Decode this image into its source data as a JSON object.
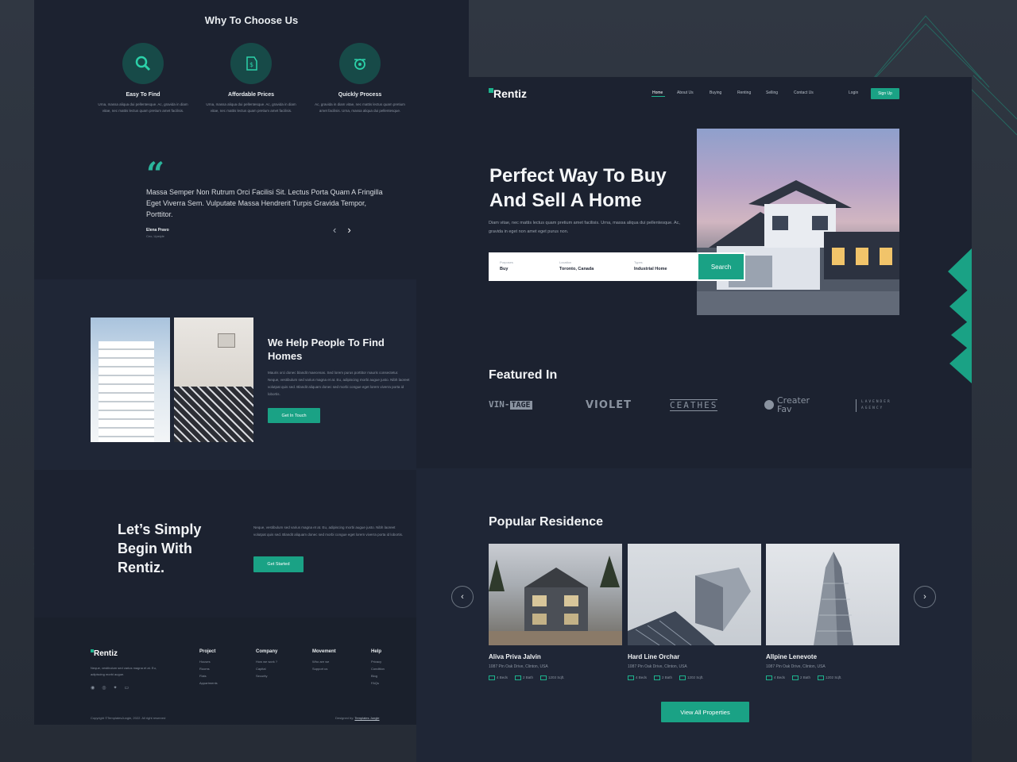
{
  "colors": {
    "accent": "#1aa285",
    "panel": "#1c2230",
    "background": "#2b313c"
  },
  "why_section": {
    "title": "Why To Choose Us",
    "features": [
      {
        "icon": "search-icon",
        "title": "Easy To Find",
        "desc": "Urna, massa aliqua dui pellentesque. Ac, gravida in diam vitae, nec mattis lectus quam pretium amet facilisis."
      },
      {
        "icon": "price-tag-icon",
        "title": "Affordable Prices",
        "desc": "Urna, massa aliqua dui pellentesque. Ac, gravida in diam vitae, nec mattis lectus quam pretium amet facilisis."
      },
      {
        "icon": "process-icon",
        "title": "Quickly Process",
        "desc": "Ac, gravida in diam vitae, nec mattis lectus quam pretium amet facilisis. Urna, massa aliqua dui pellentesque."
      }
    ]
  },
  "testimonial": {
    "text": "Massa Semper Non Rutrum Orci Facilisi Sit. Lectus Porta Quam A Fringilla Eget Viverra Sem. Vulputate Massa Hendrerit Turpis Gravida Tempor, Porttitor.",
    "name": "Elena Pravo",
    "role": "Ceo, Upstyle"
  },
  "help_section": {
    "title": "We Help People To Find Homes",
    "desc": "Mauris orci donec blandit maecenas. Sed lorem purus porttitor mauris consectetur. Neque, vestibulum sed varius magna et at. Eu, adipiscing morbi augue justo. Nibh laoreet volutpat quis sed. Blandit aliquam donec sed morbi congue eget lorem viverra porta id lobortis.",
    "button": "Get In Touch"
  },
  "cta_section": {
    "title": "Let’s Simply Begin With Rentiz.",
    "desc": "Neque, vestibulum sed varius magna et at. Eu, adipiscing morbi augue justo. Nibh laoreet volutpat quis sed. Blandit aliquam donec sed morbi congue eget lorem viverra porta id lobortis.",
    "button": "Get Started"
  },
  "footer": {
    "logo": "Rentiz",
    "desc": "Neque, vestibulum sed varius magna et at. Eu, adipiscing morbi augue.",
    "columns": [
      {
        "heading": "Project",
        "items": [
          "Houses",
          "Rooms",
          "Flats",
          "Appartments"
        ]
      },
      {
        "heading": "Company",
        "items": [
          "How we work ?",
          "Capital",
          "Security"
        ]
      },
      {
        "heading": "Movement",
        "items": [
          "Who are we",
          "Support us"
        ]
      },
      {
        "heading": "Help",
        "items": [
          "Privacy",
          "Condition",
          "Blog",
          "FAQs"
        ]
      }
    ],
    "copyright": "Copyright ©TemplatesJungle, 2022. All right reserved",
    "designed_by_label": "Designed by:",
    "designed_by_link": "Templates Jungle"
  },
  "header": {
    "logo": "Rentiz",
    "nav": [
      "Home",
      "About Us",
      "Buying",
      "Renting",
      "Selling",
      "Contact Us"
    ],
    "active_nav": "Home",
    "login": "Login",
    "signup": "Sign Up"
  },
  "hero": {
    "title": "Perfect Way To Buy And Sell A Home",
    "desc": "Diam vitae, nec mattis lectus quam pretium amet facilisis. Urna, massa aliqua dui pellentesque. Ac, gravida in eget non amet eget purus non.",
    "search": {
      "fields": [
        {
          "label": "Purposes",
          "value": "Buy"
        },
        {
          "label": "Location",
          "value": "Toronto, Canada"
        },
        {
          "label": "Types",
          "value": "Industrial Home"
        }
      ],
      "button": "Search"
    }
  },
  "featured": {
    "title": "Featured In",
    "logos": [
      "VIN-",
      "TAGE",
      "VIOLET",
      "CEATHES",
      "Creater",
      "Fav",
      "LAVENDER",
      "AGENCY"
    ]
  },
  "popular": {
    "title": "Popular Residence",
    "cards": [
      {
        "name": "Aliva Priva Jalvin",
        "address": "1087 Pin Oak Drive, Clinton, USA",
        "beds": "4 Beds",
        "bath": "2 Bath",
        "area": "1203 Sqft."
      },
      {
        "name": "Hard Line Orchar",
        "address": "1087 Pin Oak Drive, Clinton, USA",
        "beds": "4 Beds",
        "bath": "2 Bath",
        "area": "1202 Sqft."
      },
      {
        "name": "Allpine Lenevote",
        "address": "1087 Pin Oak Drive, Clinton, USA",
        "beds": "4 Beds",
        "bath": "2 Bath",
        "area": "1202 Sqft."
      }
    ],
    "prev": "‹",
    "next": "›",
    "view_all": "View All Properties"
  },
  "glyphs": {
    "quote": "“",
    "arrow_left": "‹",
    "arrow_right": "›"
  }
}
